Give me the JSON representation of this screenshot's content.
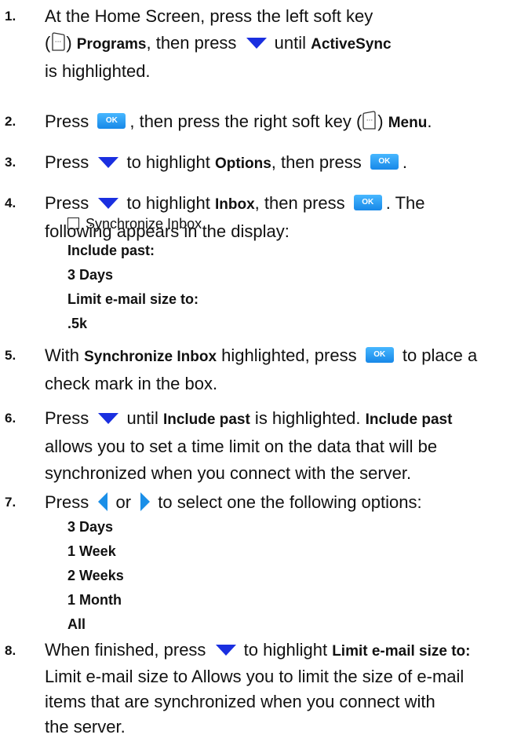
{
  "steps": [
    {
      "num": "1.",
      "t1": "At the Home Screen, press the left soft key",
      "t2": "(",
      "t3": ") ",
      "b1": "Programs",
      "t4": ", then press ",
      "t5": " until ",
      "b2": "ActiveSync",
      "t6": "is highlighted."
    },
    {
      "num": "2.",
      "t1": "Press ",
      "t2": ", then press the right soft key (",
      "t3": ") ",
      "b1": "Menu",
      "t4": "."
    },
    {
      "num": "3.",
      "t1": "Press ",
      "t2": " to highlight ",
      "b1": "Options",
      "t3": ", then press ",
      "t4": "."
    },
    {
      "num": "4.",
      "t1": "Press ",
      "t2": " to highlight ",
      "b1": "Inbox",
      "t3": ", then press ",
      "t4": ". The",
      "t5": "following appears in the display:"
    },
    {
      "num": "5.",
      "t1": "With ",
      "b1": "Synchronize Inbox",
      "t2": " highlighted, press ",
      "t3": " to place a",
      "t4": "check mark in the box."
    },
    {
      "num": "6.",
      "t1": "Press ",
      "t2": " until ",
      "b1": "Include past",
      "t3": " is highlighted. ",
      "b2": "Include past",
      "t4": "allows you to set a time limit on the data that will be",
      "t5": "synchronized when you connect with the server."
    },
    {
      "num": "7.",
      "t1": "Press ",
      "t2": " or ",
      "t3": " to select one the following options:"
    },
    {
      "num": "8.",
      "t1": "When finished, press ",
      "t2": " to highlight ",
      "b1": "Limit e-mail size to:",
      "t3": "Limit e-mail size to Allows you to limit the size of e-mail",
      "t4": "items that are synchronized when you connect with",
      "t5": "the server."
    }
  ],
  "display_items": [
    "Synchronize Inbox",
    "Include past:",
    "3 Days",
    "Limit e-mail size to:",
    ".5k"
  ],
  "options": [
    "3 Days",
    "1 Week",
    "2 Weeks",
    "1 Month",
    "All"
  ],
  "ok_label": "OK",
  "colors": {
    "down_arrow": "#1a2fe0",
    "side_arrow": "#1a8fe8",
    "ok_button": "#1788e8"
  }
}
